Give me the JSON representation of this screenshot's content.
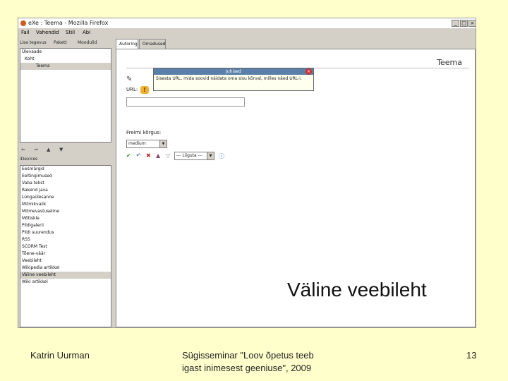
{
  "window": {
    "title": "eXe : Teema - Mozilla Firefox",
    "controls": [
      "_",
      "□",
      "×"
    ]
  },
  "menubar": {
    "items": [
      "Fail",
      "Vahendid",
      "Stiil",
      "Abi"
    ]
  },
  "left_tabs": [
    "Lisa tegevus",
    "Pakett",
    "Moodulid"
  ],
  "outline": {
    "items": [
      {
        "label": "Ülevaade",
        "selected": false
      },
      {
        "label": "Koht",
        "selected": false
      },
      {
        "label": "Teema",
        "selected": true
      }
    ]
  },
  "outline_toolbar": [
    "⇐",
    "⇒",
    "▲",
    "▼"
  ],
  "idevices": {
    "label": "iDevices",
    "items": [
      {
        "label": "Eesmärgid",
        "selected": false
      },
      {
        "label": "Eeltingimused",
        "selected": false
      },
      {
        "label": "Vaba tekst",
        "selected": false
      },
      {
        "label": "Rakend Java",
        "selected": false
      },
      {
        "label": "Lüngaülesanne",
        "selected": false
      },
      {
        "label": "Mitmikvalik",
        "selected": false
      },
      {
        "label": "Mitmevastuseline",
        "selected": false
      },
      {
        "label": "Mõtiskle",
        "selected": false
      },
      {
        "label": "Pildigalerii",
        "selected": false
      },
      {
        "label": "Pildi suurendus",
        "selected": false
      },
      {
        "label": "RSS",
        "selected": false
      },
      {
        "label": "SCORM Test",
        "selected": false
      },
      {
        "label": "Tõene-väär",
        "selected": false
      },
      {
        "label": "Veebileht",
        "selected": false
      },
      {
        "label": "Wikipedia artikkel",
        "selected": false
      },
      {
        "label": "Väline veebileht",
        "selected": true
      },
      {
        "label": "Wiki artikkel",
        "selected": false
      }
    ]
  },
  "content_tabs": [
    "Autoring",
    "Omadused"
  ],
  "content": {
    "heading": "Teema",
    "url_label": "URL:",
    "popup": {
      "title": "Juhised",
      "body": "Sisesta URL, mida soovid näidata oma sisu kõrval, milles näed URL-i.",
      "close": "×"
    },
    "frame_height_label": "Freimi kõrgus:",
    "frame_height_value": "medium",
    "extra_select_value": "--- Liiguta ---"
  },
  "slide": {
    "caption": "Väline veebileht",
    "author": "Katrin Uurman",
    "event_line1": "Sügisseminar \"Loov õpetus teeb",
    "event_line2": "igast inimesest geeniuse\", 2009",
    "page_number": "13"
  }
}
